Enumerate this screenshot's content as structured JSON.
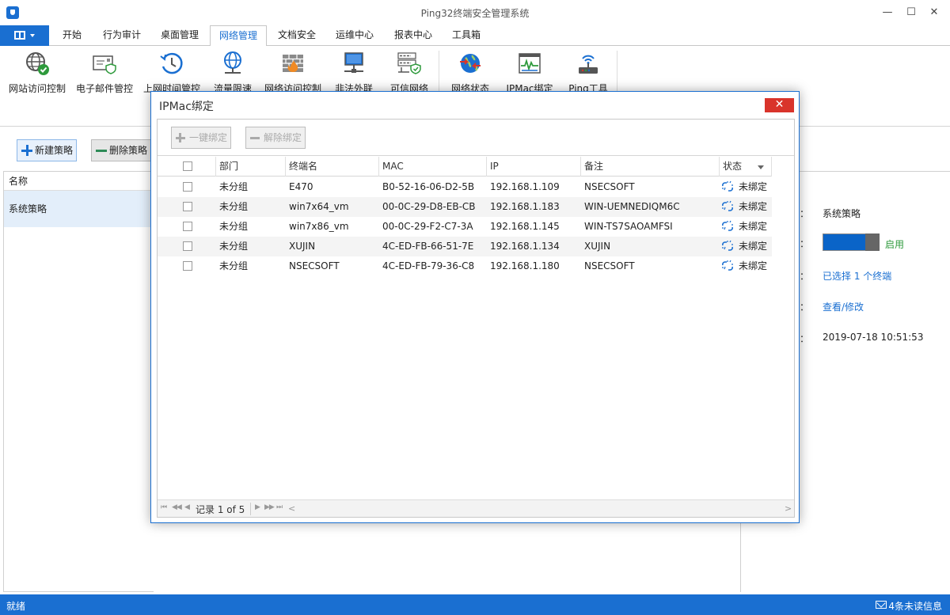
{
  "window": {
    "title": "Ping32终端安全管理系统",
    "minimize": "—",
    "maximize": "☐",
    "close": "✕"
  },
  "tabs": [
    {
      "label": "开始"
    },
    {
      "label": "行为审计"
    },
    {
      "label": "桌面管理"
    },
    {
      "label": "网络管理"
    },
    {
      "label": "文档安全"
    },
    {
      "label": "运维中心"
    },
    {
      "label": "报表中心"
    },
    {
      "label": "工具箱"
    }
  ],
  "active_tab": "网络管理",
  "ribbon": [
    {
      "label": "网站访问控制",
      "icon": "globe-check-icon"
    },
    {
      "label": "电子邮件管控",
      "icon": "email-shield-icon"
    },
    {
      "label": "上网时间管控",
      "icon": "clock-history-icon"
    },
    {
      "label": "流量限速",
      "icon": "globe-network-icon"
    },
    {
      "label": "网络访问控制",
      "icon": "firewall-icon"
    },
    {
      "label": "非法外联",
      "icon": "computer-network-icon"
    },
    {
      "label": "可信网络",
      "icon": "ip-shield-icon"
    },
    {
      "label": "网络状态",
      "icon": "globe-arrows-icon"
    },
    {
      "label": "IPMac绑定",
      "icon": "chart-window-icon"
    },
    {
      "label": "Ping工具",
      "icon": "router-icon"
    }
  ],
  "actions": {
    "new_policy": "新建策略",
    "delete_policy": "删除策略"
  },
  "left_panel": {
    "header": "名称",
    "row": "系统策略"
  },
  "right_panel": {
    "colon": "：",
    "name": "系统策略",
    "enabled": "启用",
    "selected": "已选择 1 个终端",
    "view_edit": "查看/修改",
    "time": "2019-07-18 10:51:53"
  },
  "status": {
    "left": "就绪",
    "right": "4条未读信息"
  },
  "dialog": {
    "title": "IPMac绑定",
    "close": "✕",
    "bind_all": "一键绑定",
    "unbind": "解除绑定",
    "columns": [
      "部门",
      "终端名",
      "MAC",
      "IP",
      "备注",
      "状态"
    ],
    "rows": [
      {
        "dept": "未分组",
        "name": "E470",
        "mac": "B0-52-16-06-D2-5B",
        "ip": "192.168.1.109",
        "note": "NSECSOFT",
        "status": "未绑定"
      },
      {
        "dept": "未分组",
        "name": "win7x64_vm",
        "mac": "00-0C-29-D8-EB-CB",
        "ip": "192.168.1.183",
        "note": "WIN-UEMNEDIQM6C",
        "status": "未绑定"
      },
      {
        "dept": "未分组",
        "name": "win7x86_vm",
        "mac": "00-0C-29-F2-C7-3A",
        "ip": "192.168.1.145",
        "note": "WIN-TS7SAOAMFSI",
        "status": "未绑定"
      },
      {
        "dept": "未分组",
        "name": "XUJIN",
        "mac": "4C-ED-FB-66-51-7E",
        "ip": "192.168.1.134",
        "note": "XUJIN",
        "status": "未绑定"
      },
      {
        "dept": "未分组",
        "name": "NSECSOFT",
        "mac": "4C-ED-FB-79-36-C8",
        "ip": "192.168.1.180",
        "note": "NSECSOFT",
        "status": "未绑定"
      }
    ],
    "pager": {
      "text": "记录 1 of 5",
      "first": "⏮",
      "prev_page": "◀◀",
      "prev": "◀",
      "next": "▶",
      "next_page": "▶▶",
      "last": "⏭",
      "scroll_left": "<",
      "scroll_right": ">"
    }
  },
  "colors": {
    "accent": "#1a6fd1",
    "close_red": "#d9342b",
    "enabled_green": "#2e9a3c"
  }
}
